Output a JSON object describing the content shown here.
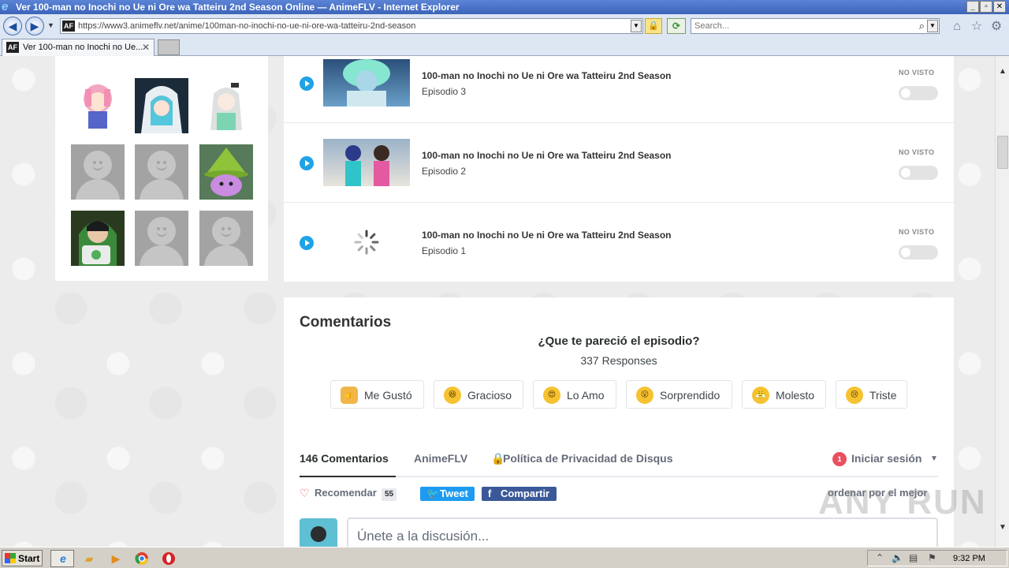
{
  "browser": {
    "window_title": "Ver 100-man no Inochi no Ue ni Ore wa Tatteiru 2nd Season Online — AnimeFLV - Internet Explorer",
    "url": "https://www3.animeflv.net/anime/100man-no-inochi-no-ue-ni-ore-wa-tatteiru-2nd-season",
    "search_placeholder": "Search...",
    "tab_label": "Ver 100-man no Inochi no Ue...",
    "site_icon_text": "AF",
    "window_buttons": {
      "minimize": "_",
      "restore": "▫",
      "close": "✕"
    }
  },
  "episodes": [
    {
      "title": "100-man no Inochi no Ue ni Ore wa Tatteiru 2nd Season",
      "episode": "Episodio 3",
      "status": "NO VISTO",
      "thumb": "image"
    },
    {
      "title": "100-man no Inochi no Ue ni Ore wa Tatteiru 2nd Season",
      "episode": "Episodio 2",
      "status": "NO VISTO",
      "thumb": "image"
    },
    {
      "title": "100-man no Inochi no Ue ni Ore wa Tatteiru 2nd Season",
      "episode": "Episodio 1",
      "status": "NO VISTO",
      "thumb": "loading"
    }
  ],
  "followers": [
    "anime-girl-pink",
    "anime-girl-hood",
    "anime-girl-white",
    "default",
    "default",
    "witch-hat",
    "anime-boy-green",
    "default",
    "default"
  ],
  "comments": {
    "heading": "Comentarios",
    "question": "¿Que te pareció el episodio?",
    "responses": "337 Responses",
    "reactions": [
      {
        "label": "Me Gustó",
        "face": "👍"
      },
      {
        "label": "Gracioso",
        "face": "😆"
      },
      {
        "label": "Lo Amo",
        "face": "😍"
      },
      {
        "label": "Sorprendido",
        "face": "😮"
      },
      {
        "label": "Molesto",
        "face": "😤"
      },
      {
        "label": "Triste",
        "face": "😢"
      }
    ],
    "tabs": {
      "count": "146 Comentarios",
      "community": "AnimeFLV",
      "privacy": "Política de Privacidad de Disqus",
      "login": "Iniciar sesión",
      "login_badge": "1"
    },
    "recommend": "Recomendar",
    "recommend_count": "55",
    "tweet": "Tweet",
    "share": "Compartir",
    "order": "ordenar por el mejor",
    "composer_placeholder": "Únete a la discusión..."
  },
  "watermark": "ANY RUN",
  "taskbar": {
    "start": "Start",
    "clock": "9:32 PM"
  },
  "colors": {
    "accent": "#1fa3e6",
    "twitter": "#1d9bf0",
    "facebook": "#3b5998",
    "badge": "#e9505f"
  }
}
